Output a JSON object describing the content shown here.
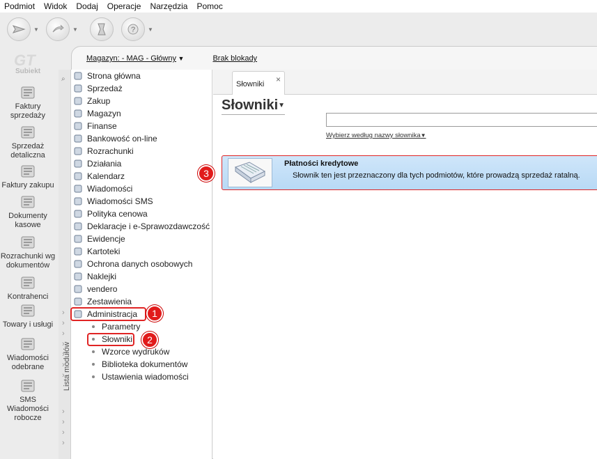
{
  "menubar": [
    "Podmiot",
    "Widok",
    "Dodaj",
    "Operacje",
    "Narzędzia",
    "Pomoc"
  ],
  "brand": "Subiekt",
  "launch_items": [
    {
      "label": "Faktury sprzedaży",
      "icon": "invoices-icon"
    },
    {
      "label": "Sprzedaż detaliczna",
      "icon": "retail-sale-icon"
    },
    {
      "label": "Faktury zakupu",
      "icon": "purchase-invoices-icon"
    },
    {
      "label": "Dokumenty kasowe",
      "icon": "cash-documents-icon"
    },
    {
      "label": "Rozrachunki wg dokumentów",
      "icon": "settlements-icon"
    },
    {
      "label": "Kontrahenci",
      "icon": "contractors-icon"
    },
    {
      "label": "Towary i usługi",
      "icon": "goods-icon"
    },
    {
      "label": "Wiadomości odebrane",
      "icon": "inbox-icon"
    },
    {
      "label": "SMS Wiadomości robocze",
      "icon": "sms-icon"
    }
  ],
  "status": {
    "warehouse": "Magazyn: - MAG - Główny",
    "lock": "Brak blokady"
  },
  "module_strip_label": "Lista modułów",
  "tree": [
    {
      "label": "Strona główna",
      "icon": "home-icon"
    },
    {
      "label": "Sprzedaż",
      "icon": "sales-icon"
    },
    {
      "label": "Zakup",
      "icon": "purchase-icon"
    },
    {
      "label": "Magazyn",
      "icon": "warehouse-icon"
    },
    {
      "label": "Finanse",
      "icon": "finance-icon"
    },
    {
      "label": "Bankowość on-line",
      "icon": "bank-icon"
    },
    {
      "label": "Rozrachunki",
      "icon": "settlements-icon"
    },
    {
      "label": "Działania",
      "icon": "actions-icon"
    },
    {
      "label": "Kalendarz",
      "icon": "calendar-icon"
    },
    {
      "label": "Wiadomości",
      "icon": "messages-icon"
    },
    {
      "label": "Wiadomości SMS",
      "icon": "sms-icon"
    },
    {
      "label": "Polityka cenowa",
      "icon": "pricing-icon"
    },
    {
      "label": "Deklaracje i e-Sprawozdawczość",
      "icon": "declarations-icon"
    },
    {
      "label": "Ewidencje",
      "icon": "records-icon"
    },
    {
      "label": "Kartoteki",
      "icon": "files-icon"
    },
    {
      "label": "Ochrona danych osobowych",
      "icon": "shield-icon"
    },
    {
      "label": "Naklejki",
      "icon": "labels-icon"
    },
    {
      "label": "vendero",
      "icon": "vendero-icon"
    },
    {
      "label": "Zestawienia",
      "icon": "reports-icon"
    },
    {
      "label": "Administracja",
      "icon": "admin-icon"
    }
  ],
  "tree_children": [
    "Parametry",
    "Słowniki",
    "Wzorce wydruków",
    "Biblioteka dokumentów",
    "Ustawienia wiadomości"
  ],
  "tab": {
    "label": "Słowniki",
    "close": "×"
  },
  "page_title": "Słowniki",
  "search": {
    "value": "",
    "placeholder": ""
  },
  "filter_label": "Wybierz według nazwy słownika",
  "dictionary": {
    "title": "Płatności kredytowe",
    "description": "Słownik ten jest przeznaczony dla tych podmiotów, które prowadzą sprzedaż ratalną."
  },
  "callouts": [
    "1",
    "2",
    "3"
  ],
  "colors": {
    "highlight": "#e02424",
    "selection": "#c4e0f8",
    "callout": "#e11b1b"
  }
}
